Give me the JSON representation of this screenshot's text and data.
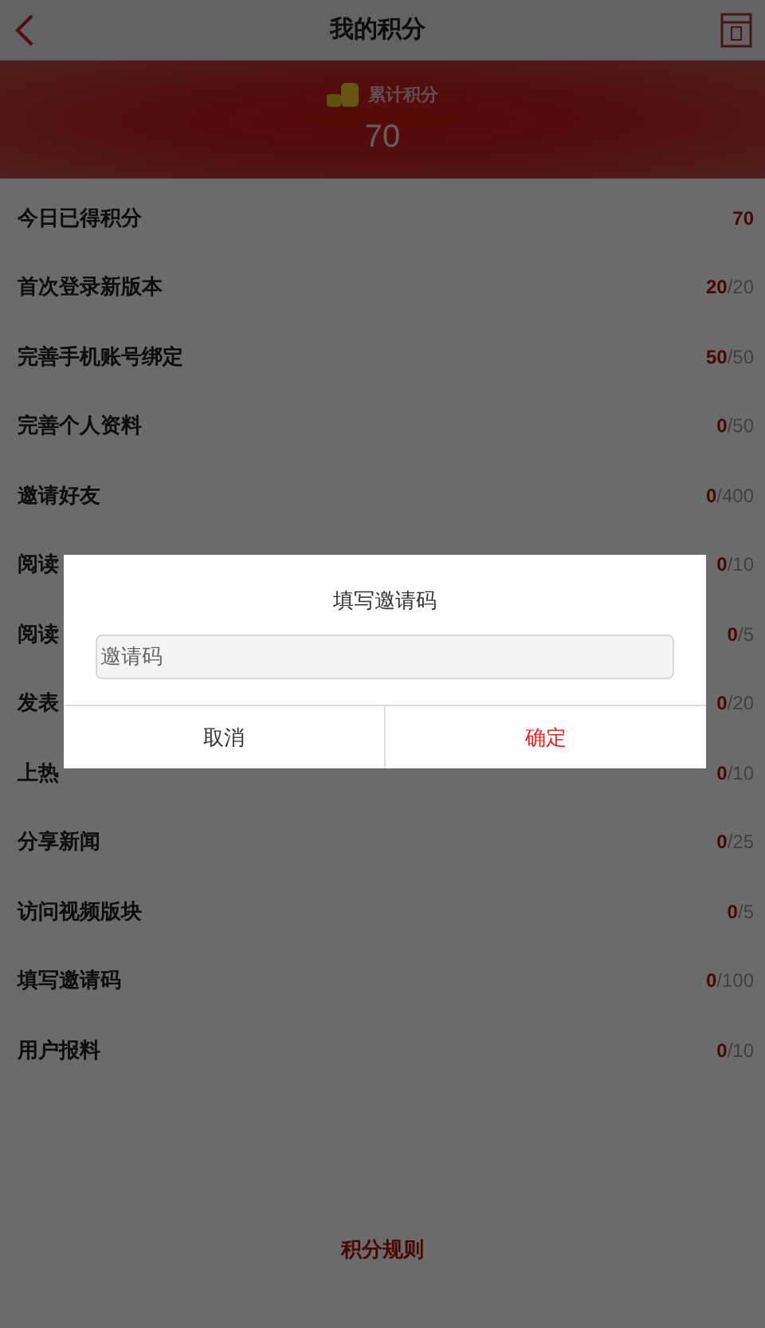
{
  "header": {
    "title": "我的积分"
  },
  "summary": {
    "label": "累计积分",
    "value": "70"
  },
  "rows": [
    {
      "label": "今日已得积分",
      "earned": "70"
    },
    {
      "label": "首次登录新版本",
      "earned": "20",
      "total": "/20"
    },
    {
      "label": "完善手机账号绑定",
      "earned": "50",
      "total": "/50"
    },
    {
      "label": "完善个人资料",
      "earned": "0",
      "total": "/50"
    },
    {
      "label": "邀请好友",
      "earned": "0",
      "total": "/400"
    },
    {
      "label": "阅读",
      "earned": "0",
      "total": "/10"
    },
    {
      "label": "阅读",
      "earned": "0",
      "total": "/5"
    },
    {
      "label": "发表",
      "earned": "0",
      "total": "/20"
    },
    {
      "label": "上热",
      "earned": "0",
      "total": "/10"
    },
    {
      "label": "分享新闻",
      "earned": "0",
      "total": "/25"
    },
    {
      "label": "访问视频版块",
      "earned": "0",
      "total": "/5"
    },
    {
      "label": "填写邀请码",
      "earned": "0",
      "total": "/100"
    },
    {
      "label": "用户报料",
      "earned": "0",
      "total": "/10"
    }
  ],
  "footer_link": "积分规则",
  "dialog": {
    "title": "填写邀请码",
    "input": {
      "placeholder": "邀请码"
    },
    "buttons": [
      {
        "label": "取消",
        "kind": "cancel"
      },
      {
        "label": "确定",
        "kind": "confirm"
      }
    ]
  }
}
